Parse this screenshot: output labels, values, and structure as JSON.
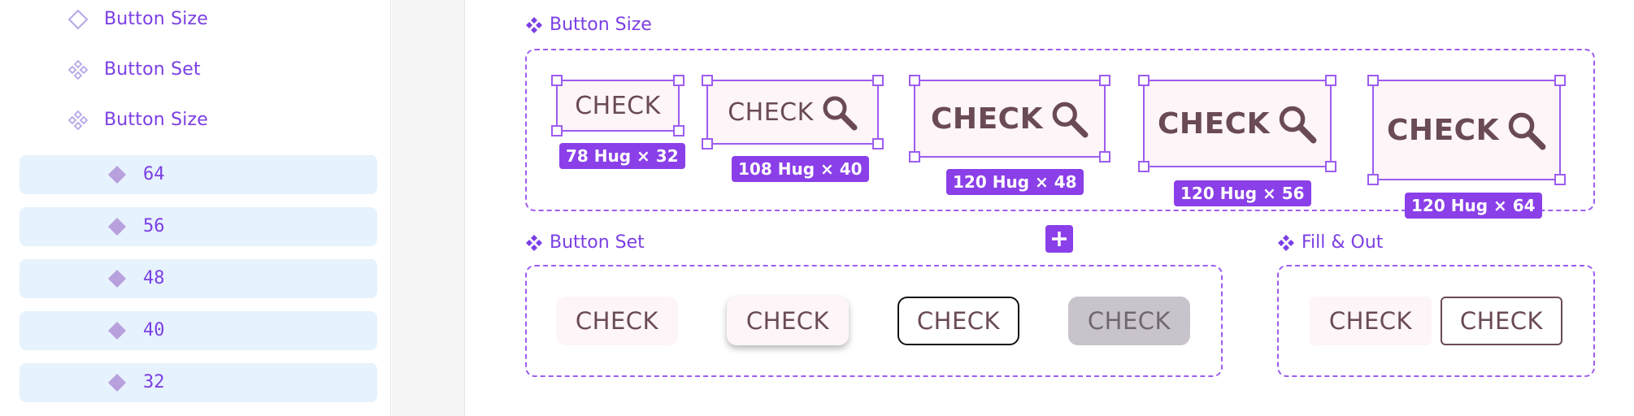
{
  "layers": {
    "components": [
      {
        "label": "Button Size",
        "icon": "component-outline-icon"
      },
      {
        "label": "Button Set",
        "icon": "component-set-icon"
      },
      {
        "label": "Button Size",
        "icon": "component-set-icon"
      }
    ],
    "variants": [
      "64",
      "56",
      "48",
      "40",
      "32"
    ]
  },
  "canvas": {
    "size_frame": {
      "title": "Button Size",
      "buttons": [
        {
          "label": "CHECK",
          "badge": "78 Hug × 32",
          "has_search_icon": false
        },
        {
          "label": "CHECK",
          "badge": "108 Hug × 40",
          "has_search_icon": true
        },
        {
          "label": "CHECK",
          "badge": "120 Hug × 48",
          "has_search_icon": true
        },
        {
          "label": "CHECK",
          "badge": "120 Hug × 56",
          "has_search_icon": true
        },
        {
          "label": "CHECK",
          "badge": "120 Hug × 64",
          "has_search_icon": true
        }
      ]
    },
    "set_frame": {
      "title": "Button Set",
      "buttons": [
        {
          "label": "CHECK",
          "style": "flat"
        },
        {
          "label": "CHECK",
          "style": "elevated"
        },
        {
          "label": "CHECK",
          "style": "outlined"
        },
        {
          "label": "CHECK",
          "style": "disabled"
        }
      ]
    },
    "fill_frame": {
      "title": "Fill & Out",
      "buttons": [
        {
          "label": "CHECK",
          "style": "fill"
        },
        {
          "label": "CHECK",
          "style": "outline"
        }
      ]
    },
    "add_variant_icon": "plus-icon"
  },
  "colors": {
    "accent": "#8a3fe8",
    "layer_text": "#7b3fe4",
    "variant_row_bg": "#e6f2fd",
    "button_text": "#6a4a55",
    "button_bg": "#fdf5f8",
    "disabled_bg": "#c9c4cc"
  }
}
